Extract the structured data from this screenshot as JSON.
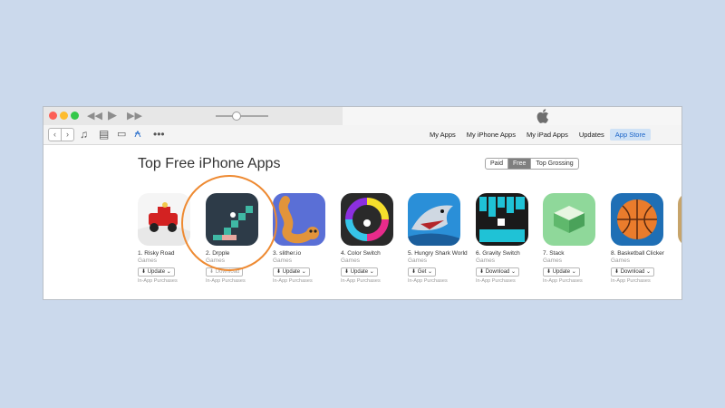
{
  "window": {
    "nav_tabs": [
      "My Apps",
      "My iPhone Apps",
      "My iPad Apps",
      "Updates",
      "App Store"
    ],
    "active_tab": "App Store"
  },
  "page": {
    "title": "Top Free iPhone Apps",
    "segments": [
      "Paid",
      "Free",
      "Top Grossing"
    ],
    "selected_segment": "Free"
  },
  "apps": [
    {
      "name": "1. Risky Road",
      "category": "Games",
      "button": "Update",
      "iap": "In-App Purchases",
      "icon": "car-road-icon"
    },
    {
      "name": "2. Drpple",
      "category": "Games",
      "button": "Download",
      "iap": "In-App Purchases",
      "icon": "stairs-icon"
    },
    {
      "name": "3. slither.io",
      "category": "Games",
      "button": "Update",
      "iap": "In-App Purchases",
      "icon": "snake-icon"
    },
    {
      "name": "4. Color Switch",
      "category": "Games",
      "button": "Update",
      "iap": "In-App Purchases",
      "icon": "color-ring-icon"
    },
    {
      "name": "5. Hungry Shark World",
      "category": "Games",
      "button": "Get",
      "iap": "In-App Purchases",
      "icon": "shark-icon"
    },
    {
      "name": "6. Gravity Switch",
      "category": "Games",
      "button": "Download",
      "iap": "In-App Purchases",
      "icon": "cube-cave-icon"
    },
    {
      "name": "7. Stack",
      "category": "Games",
      "button": "Update",
      "iap": "In-App Purchases",
      "icon": "stack-icon"
    },
    {
      "name": "8. Basketball Clicker",
      "category": "Games",
      "button": "Download",
      "iap": "In-App Purchases",
      "icon": "basketball-icon"
    }
  ],
  "colors": {
    "highlight_circle": "#ee8a32",
    "accent": "#1a64c8"
  }
}
